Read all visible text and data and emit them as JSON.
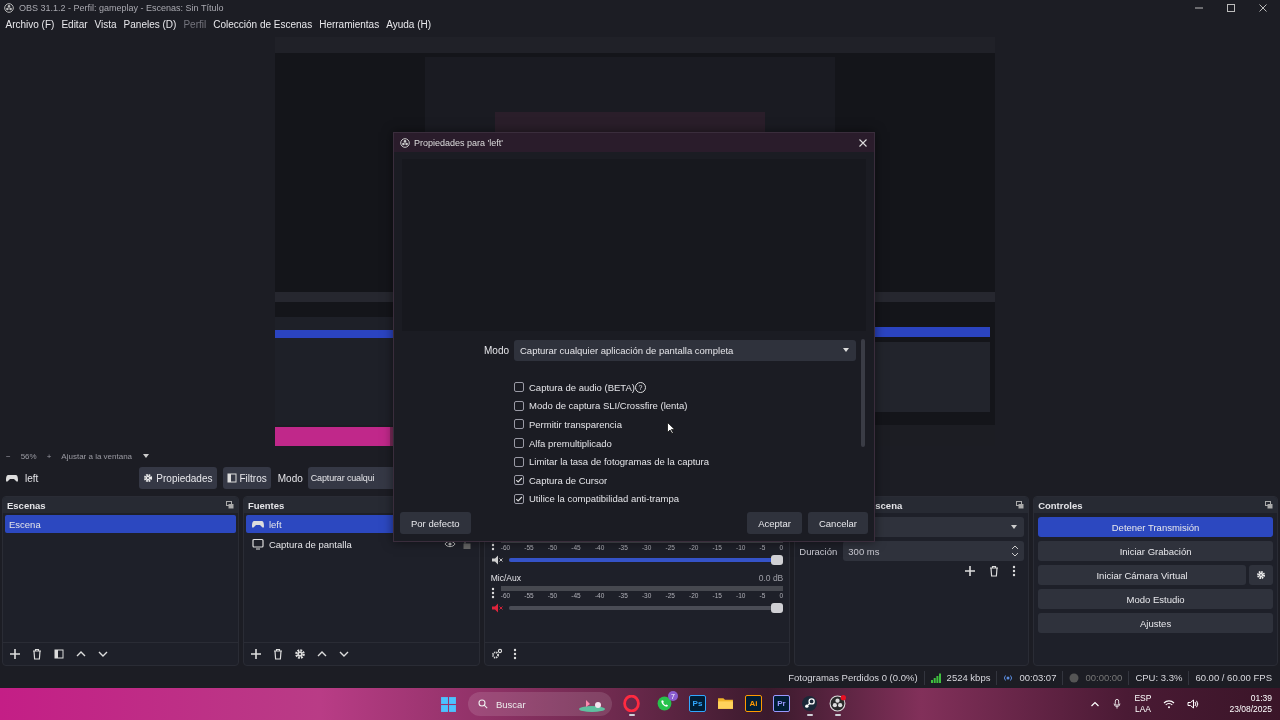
{
  "window": {
    "title": "OBS 31.1.2 - Perfil: gameplay - Escenas: Sin Título"
  },
  "menu": [
    {
      "label": "Archivo (F)",
      "disabled": false
    },
    {
      "label": "Editar",
      "disabled": false
    },
    {
      "label": "Vista",
      "disabled": false
    },
    {
      "label": "Paneles (D)",
      "disabled": false
    },
    {
      "label": "Perfil",
      "disabled": true
    },
    {
      "label": "Colección de Escenas",
      "disabled": false
    },
    {
      "label": "Herramientas",
      "disabled": false
    },
    {
      "label": "Ayuda (H)",
      "disabled": false
    }
  ],
  "zoom_bar": {
    "minus": "−",
    "zoom": "56%",
    "plus": "+",
    "fit": "Ajustar a la ventana"
  },
  "source_toolbar": {
    "source": "left",
    "properties": "Propiedades",
    "filters": "Filtros",
    "mode_label": "Modo",
    "mode_value": "Capturar cualqui"
  },
  "scenes": {
    "title": "Escenas",
    "items": [
      {
        "label": "Escena",
        "selected": true
      }
    ]
  },
  "sources": {
    "title": "Fuentes",
    "items": [
      {
        "label": "left",
        "kind": "game",
        "selected": true
      },
      {
        "label": "Captura de pantalla",
        "kind": "display",
        "selected": false,
        "visible": true,
        "locked": false
      }
    ]
  },
  "mixer": {
    "channels": [
      {
        "muted": false,
        "level": 1,
        "scale": [
          "-60",
          "-55",
          "-50",
          "-45",
          "-40",
          "-35",
          "-30",
          "-25",
          "-20",
          "-15",
          "-10",
          "-5",
          "0"
        ]
      },
      {
        "name": "Mic/Aux",
        "reading": "0.0 dB",
        "muted": true,
        "level": 1,
        "scale": [
          "-60",
          "-55",
          "-50",
          "-45",
          "-40",
          "-35",
          "-30",
          "-25",
          "-20",
          "-15",
          "-10",
          "-5",
          "0"
        ]
      }
    ]
  },
  "transitions": {
    "title": "scena",
    "duration_label": "Duración",
    "duration": "300 ms"
  },
  "controls": {
    "title": "Controles",
    "buttons": [
      {
        "label": "Detener Transmisión",
        "active": true
      },
      {
        "label": "Iniciar Grabación",
        "active": false
      },
      {
        "label": "Iniciar Cámara Virtual",
        "active": false,
        "settings": true
      },
      {
        "label": "Modo Estudio",
        "active": false
      },
      {
        "label": "Ajustes",
        "active": false
      }
    ]
  },
  "status_bar": {
    "dropped": "Fotogramas Perdidos 0 (0.0%)",
    "bitrate": "2524 kbps",
    "stream_time": "00:03:07",
    "record_time": "00:00:00",
    "cpu": "CPU: 3.3%",
    "fps": "60.00 / 60.00 FPS"
  },
  "dialog": {
    "title": "Propiedades para 'left'",
    "mode_label": "Modo",
    "mode_value": "Capturar cualquier aplicación de pantalla completa",
    "options": [
      {
        "label": "Captura de audio (BETA)",
        "checked": false,
        "help": "?"
      },
      {
        "label": "Modo de captura SLI/Crossfire (lenta)",
        "checked": false
      },
      {
        "label": "Permitir transparencia",
        "checked": false
      },
      {
        "label": "Alfa premultiplicado",
        "checked": false
      },
      {
        "label": "Limitar la tasa de fotogramas de la captura",
        "checked": false
      },
      {
        "label": "Captura de Cursor",
        "checked": true
      },
      {
        "label": "Utilice la compatibilidad anti-trampa",
        "checked": true
      }
    ],
    "defaults": "Por defecto",
    "ok": "Aceptar",
    "cancel": "Cancelar"
  },
  "taskbar": {
    "search": "Buscar",
    "apps": [
      {
        "kind": "opera",
        "running": true
      },
      {
        "kind": "whatsapp",
        "badge": "7",
        "running": false
      },
      {
        "kind": "adobe",
        "label": "Ps",
        "color": "#31a8ff",
        "running": false
      },
      {
        "kind": "folder",
        "running": false
      },
      {
        "kind": "adobe",
        "label": "Ai",
        "color": "#ff9a00",
        "running": false
      },
      {
        "kind": "adobe",
        "label": "Pr",
        "color": "#9999ff",
        "running": false
      },
      {
        "kind": "steam",
        "running": true
      },
      {
        "kind": "obs",
        "running": true
      }
    ],
    "lang": "ESP",
    "layout": "LAA",
    "time": "01:39",
    "date": "23/08/2025"
  }
}
